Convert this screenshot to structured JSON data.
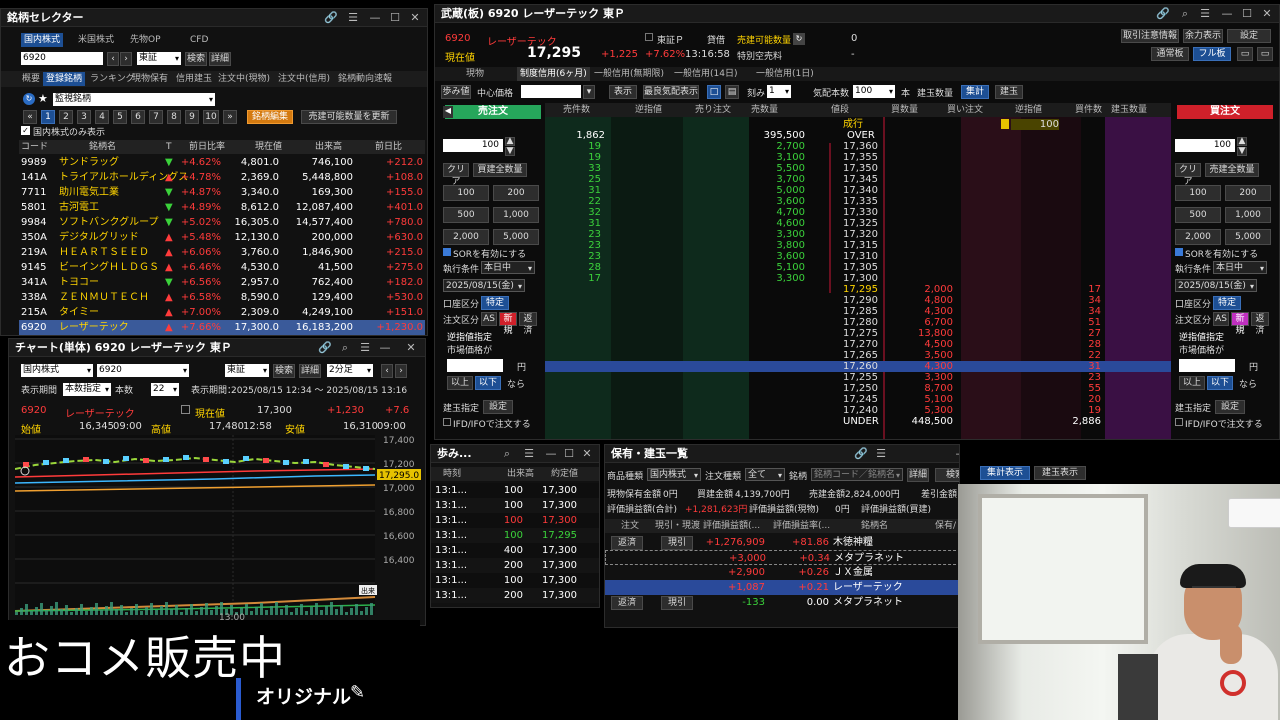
{
  "selector": {
    "title": "銘柄セレクター",
    "market_tabs": [
      "国内株式",
      "米国株式",
      "先物OP",
      "CFD"
    ],
    "code": "6920",
    "exchange": "東証",
    "search": "検索",
    "detail": "詳細",
    "sub_tabs": [
      "概要",
      "登録銘柄",
      "ランキング",
      "現物保有",
      "信用建玉",
      "注文中(現物)",
      "注文中(信用)",
      "銘柄動向速報"
    ],
    "list_name": "監視銘柄",
    "pages": [
      "1",
      "2",
      "3",
      "4",
      "5",
      "6",
      "7",
      "8",
      "9",
      "10"
    ],
    "edit_btn": "銘柄編集",
    "refresh_btn": "売建可能数量を更新",
    "domestic_only": "国内株式のみ表示",
    "headers": [
      "コード",
      "銘柄名",
      "T",
      "前日比率",
      "現在値",
      "出来高",
      "前日比"
    ],
    "rows": [
      {
        "code": "9989",
        "name": "サンドラッグ",
        "t": "▼",
        "pct": "+4.62%",
        "price": "4,801.0",
        "vol": "746,100",
        "chg": "+212.0"
      },
      {
        "code": "141A",
        "name": "トライアルホールディングス",
        "t": "▲",
        "pct": "+4.78%",
        "price": "2,369.0",
        "vol": "5,448,800",
        "chg": "+108.0"
      },
      {
        "code": "7711",
        "name": "助川電気工業",
        "t": "▼",
        "pct": "+4.87%",
        "price": "3,340.0",
        "vol": "169,300",
        "chg": "+155.0"
      },
      {
        "code": "5801",
        "name": "古河電工",
        "t": "▼",
        "pct": "+4.89%",
        "price": "8,612.0",
        "vol": "12,087,400",
        "chg": "+401.0"
      },
      {
        "code": "9984",
        "name": "ソフトバンクグループ",
        "t": "▼",
        "pct": "+5.02%",
        "price": "16,305.0",
        "vol": "14,577,400",
        "chg": "+780.0"
      },
      {
        "code": "350A",
        "name": "デジタルグリッド",
        "t": "▲",
        "pct": "+5.48%",
        "price": "12,130.0",
        "vol": "200,000",
        "chg": "+630.0"
      },
      {
        "code": "219A",
        "name": "ＨＥＡＲＴＳＥＥＤ",
        "t": "▲",
        "pct": "+6.06%",
        "price": "3,760.0",
        "vol": "1,846,900",
        "chg": "+215.0"
      },
      {
        "code": "9145",
        "name": "ビーイングＨＬＤＧＳ",
        "t": "▲",
        "pct": "+6.46%",
        "price": "4,530.0",
        "vol": "41,500",
        "chg": "+275.0"
      },
      {
        "code": "341A",
        "name": "トヨコー",
        "t": "▼",
        "pct": "+6.56%",
        "price": "2,957.0",
        "vol": "762,400",
        "chg": "+182.0"
      },
      {
        "code": "338A",
        "name": "ＺＥＮＭＵＴＥＣＨ",
        "t": "▲",
        "pct": "+6.58%",
        "price": "8,590.0",
        "vol": "129,400",
        "chg": "+530.0"
      },
      {
        "code": "215A",
        "name": "タイミー",
        "t": "▲",
        "pct": "+7.00%",
        "price": "2,309.0",
        "vol": "4,249,100",
        "chg": "+151.0"
      },
      {
        "code": "6920",
        "name": "レーザーテック",
        "t": "▲",
        "pct": "+7.66%",
        "price": "17,300.0",
        "vol": "16,183,200",
        "chg": "+1,230.0"
      }
    ]
  },
  "chart": {
    "title": "チャート(単体) 6920 レーザーテック 東Ｐ",
    "market": "国内株式",
    "code": "6920",
    "exchange": "東証",
    "search": "検索",
    "detail": "詳細",
    "interval": "2分足",
    "period_label": "表示期間",
    "period_mode": "本数指定",
    "count_label": "本数",
    "count": "22",
    "range_label": "表示期間：",
    "range": "2025/08/15 12:34 ～ 2025/08/15 13:16",
    "code2": "6920",
    "name": "レーザーテック",
    "now_label": "現在値",
    "now": "17,300",
    "chg": "+1,230",
    "chg2": "+7.6",
    "open_label": "始値",
    "open": "16,345",
    "open_t": "09:00",
    "high_label": "高値",
    "high": "17,480",
    "high_t": "12:58",
    "low_label": "安値",
    "low": "16,310",
    "low_t": "09:00",
    "y_ticks": [
      "17,400",
      "17,200",
      "17,000",
      "16,800",
      "16,600",
      "16,400"
    ],
    "last_tag": "17,295.0",
    "x_tick": "13:00",
    "tag2": "出来"
  },
  "board": {
    "title": "武蔵(板) 6920 レーザーテック 東Ｐ",
    "code": "6920",
    "name": "レーザーテック",
    "price_label": "現在値",
    "price": "17,295",
    "chg": "+1,225",
    "pct": "+7.62%",
    "time": "13:16:58",
    "exch": "東証Ｐ",
    "lend": "貸借",
    "sellable": "売建可能数量",
    "sellable_v": "0",
    "short": "特別空売料",
    "short_v": "-",
    "top_btns": [
      "取引注意情報",
      "余力表示",
      "設定"
    ],
    "mode_btns": [
      "通常板",
      "フル板"
    ],
    "tabs": [
      "現物",
      "制度信用(6ヶ月)",
      "一般信用(無期限)",
      "一般信用(14日)",
      "一般信用(1日)"
    ],
    "tool": {
      "ticks": "歩み値",
      "center": "中心価格",
      "show": "表示",
      "best": "最良気配表示",
      "tick": "刻み",
      "tick_v": "1",
      "qty": "気配本数",
      "qty_v": "100",
      "unit": "本",
      "build": "建玉数量",
      "sum": "集計",
      "build2": "建玉"
    },
    "headers": [
      "売件数",
      "逆指値",
      "売り注文",
      "売数量",
      "値段",
      "買数量",
      "買い注文",
      "逆指値",
      "買件数",
      "建玉数量"
    ],
    "over": {
      "label": "OVER",
      "sell_cnt": "1,862",
      "sell_qty": "395,500",
      "buy_rev": "100"
    },
    "under": {
      "label": "UNDER",
      "buy_qty": "448,500",
      "buy_cnt": "2,886"
    },
    "market_row": "成行",
    "asks": [
      {
        "cnt": "19",
        "qty": "2,700",
        "price": "17,360"
      },
      {
        "cnt": "19",
        "qty": "3,100",
        "price": "17,355"
      },
      {
        "cnt": "33",
        "qty": "5,500",
        "price": "17,350"
      },
      {
        "cnt": "25",
        "qty": "3,700",
        "price": "17,345"
      },
      {
        "cnt": "31",
        "qty": "5,000",
        "price": "17,340"
      },
      {
        "cnt": "22",
        "qty": "3,600",
        "price": "17,335"
      },
      {
        "cnt": "32",
        "qty": "4,700",
        "price": "17,330"
      },
      {
        "cnt": "31",
        "qty": "4,600",
        "price": "17,325"
      },
      {
        "cnt": "23",
        "qty": "3,300",
        "price": "17,320"
      },
      {
        "cnt": "23",
        "qty": "3,800",
        "price": "17,315"
      },
      {
        "cnt": "23",
        "qty": "3,600",
        "price": "17,310"
      },
      {
        "cnt": "28",
        "qty": "5,100",
        "price": "17,305"
      },
      {
        "cnt": "17",
        "qty": "3,300",
        "price": "17,300"
      }
    ],
    "bids": [
      {
        "price": "17,295",
        "qty": "2,000",
        "cnt": "17"
      },
      {
        "price": "17,290",
        "qty": "4,800",
        "cnt": "34"
      },
      {
        "price": "17,285",
        "qty": "4,300",
        "cnt": "34"
      },
      {
        "price": "17,280",
        "qty": "6,700",
        "cnt": "51"
      },
      {
        "price": "17,275",
        "qty": "13,800",
        "cnt": "27"
      },
      {
        "price": "17,270",
        "qty": "4,500",
        "cnt": "28"
      },
      {
        "price": "17,265",
        "qty": "3,500",
        "cnt": "22"
      },
      {
        "price": "17,260",
        "qty": "4,300",
        "cnt": "31"
      },
      {
        "price": "17,255",
        "qty": "3,300",
        "cnt": "23"
      },
      {
        "price": "17,250",
        "qty": "8,700",
        "cnt": "55"
      },
      {
        "price": "17,245",
        "qty": "5,100",
        "cnt": "20"
      },
      {
        "price": "17,240",
        "qty": "5,300",
        "cnt": "19"
      }
    ],
    "sell_panel": {
      "label": "売注文",
      "qty": "100",
      "clear": "クリア",
      "all": "買建全数量",
      "q": [
        "100",
        "200",
        "500",
        "1,000",
        "2,000",
        "5,000"
      ],
      "sor": "SORを有効にする",
      "exec": "執行条件",
      "exec_v": "本日中",
      "date": "2025/08/15(金)",
      "acct": "口座区分",
      "acct_v": "特定",
      "kind": "注文区分",
      "as": "AS",
      "new": "新規",
      "ret": "返済",
      "rev": "逆指値指定",
      "mkt": "市場価格が",
      "yen": "円",
      "above": "以上",
      "below": "以下",
      "then": "なら",
      "build": "建玉指定",
      "set": "設定",
      "ifd": "IFD/IFOで注文する"
    },
    "buy_panel": {
      "label": "買注文",
      "qty": "100",
      "clear": "クリア",
      "all": "売建全数量",
      "q": [
        "100",
        "200",
        "500",
        "1,000",
        "2,000",
        "5,000"
      ],
      "sor": "SORを有効にする",
      "exec": "執行条件",
      "exec_v": "本日中",
      "date": "2025/08/15(金)",
      "acct": "口座区分",
      "acct_v": "特定",
      "kind": "注文区分",
      "as": "AS",
      "new": "新規",
      "ret": "返済",
      "rev": "逆指値指定",
      "mkt": "市場価格が",
      "yen": "円",
      "above": "以上",
      "below": "以下",
      "then": "なら",
      "build": "建玉指定",
      "set": "設定",
      "ifd": "IFD/IFOで注文する"
    }
  },
  "ticks": {
    "title": "歩み...",
    "headers": [
      "時刻",
      "出来高",
      "約定値"
    ],
    "rows": [
      {
        "t": "13:1...",
        "v": "100",
        "p": "17,300",
        "c": "wht"
      },
      {
        "t": "13:1...",
        "v": "100",
        "p": "17,300",
        "c": "wht"
      },
      {
        "t": "13:1...",
        "v": "100",
        "p": "17,300",
        "c": "red"
      },
      {
        "t": "13:1...",
        "v": "100",
        "p": "17,295",
        "c": "grn"
      },
      {
        "t": "13:1...",
        "v": "400",
        "p": "17,300",
        "c": "wht"
      },
      {
        "t": "13:1...",
        "v": "200",
        "p": "17,300",
        "c": "wht"
      },
      {
        "t": "13:1...",
        "v": "100",
        "p": "17,300",
        "c": "wht"
      },
      {
        "t": "13:1...",
        "v": "200",
        "p": "17,300",
        "c": "wht"
      }
    ]
  },
  "holdings": {
    "title": "保有・建玉一覧",
    "kind_label": "商品種類",
    "kind": "国内株式",
    "otype_label": "注文種類",
    "otype": "全て",
    "stock_label": "銘柄",
    "stock_ph": "銘柄コード／銘柄名",
    "detail": "詳細",
    "search": "検索",
    "sum": "集計表示",
    "pos": "建玉表示",
    "cash_label": "現物保有金額",
    "cash": "0円",
    "buy_label": "買建金額",
    "buy": "4,139,700円",
    "sell_label": "売建金額",
    "sell": "2,824,000円",
    "diff_label": "差引金額",
    "pl_total_label": "評価損益額(合計)",
    "pl_total": "+1,281,623円",
    "pl_cash_label": "評価損益額(現物)",
    "pl_cash": "0円",
    "pl_pos_label": "評価損益額(買建)",
    "headers": [
      "注文",
      "現引・現渡",
      "評価損益額(...",
      "評価損益率(...",
      "銘柄名",
      "保有/"
    ],
    "rows": [
      {
        "o": "返済",
        "g": "現引",
        "pl": "+1,276,909",
        "r": "+81.86",
        "n": "木徳神糧"
      },
      {
        "o": "",
        "g": "",
        "pl": "+3,000",
        "r": "+0.34",
        "n": "メタプラネット"
      },
      {
        "o": "",
        "g": "",
        "pl": "+2,900",
        "r": "+0.26",
        "n": "ＪＸ金属"
      },
      {
        "o": "",
        "g": "",
        "pl": "+1,087",
        "r": "+0.21",
        "n": "レーザーテック"
      },
      {
        "o": "返済",
        "g": "現引",
        "pl": "-133",
        "r": "0.00",
        "n": "メタプラネット"
      }
    ]
  },
  "overlay": {
    "big": "おコメ販売中",
    "tag": "オリジナル"
  }
}
